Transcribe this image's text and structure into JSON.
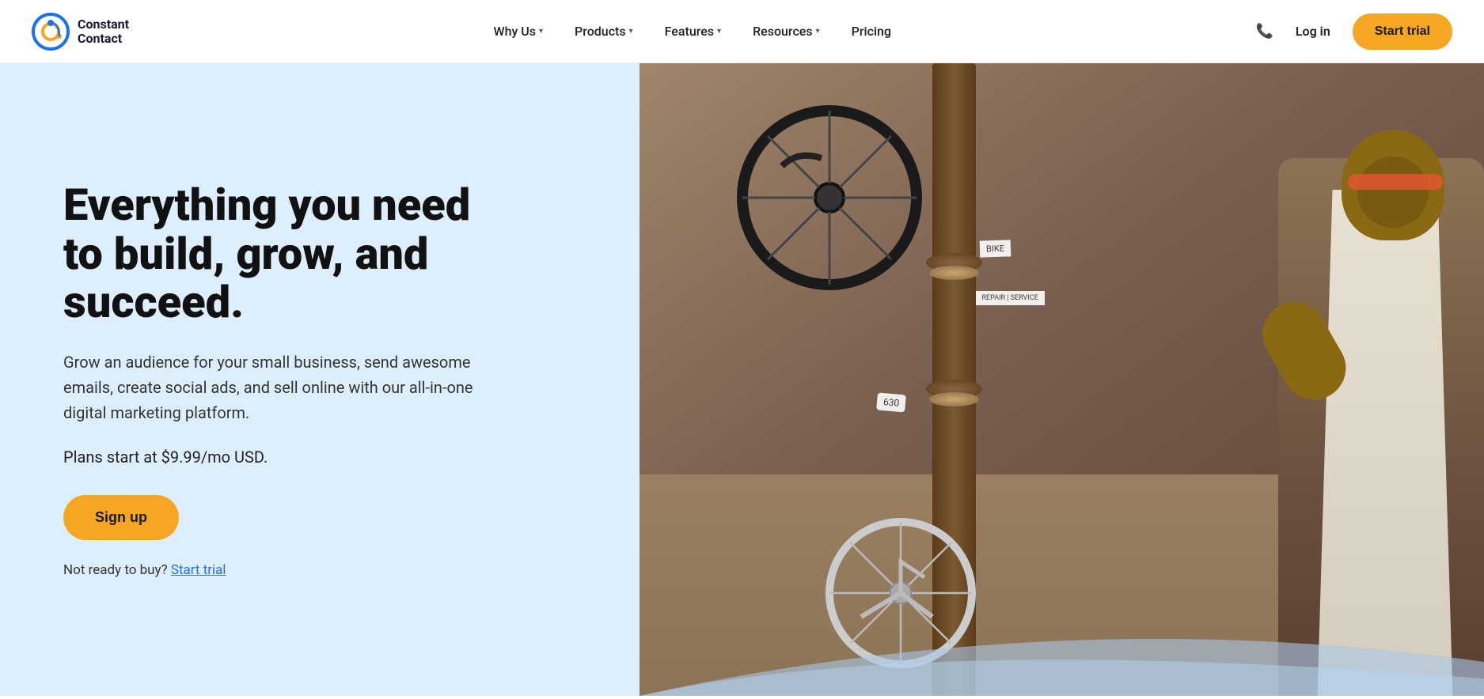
{
  "navbar": {
    "logo": {
      "line1": "Constant",
      "line2": "Contact"
    },
    "nav_items": [
      {
        "label": "Why Us",
        "has_dropdown": true
      },
      {
        "label": "Products",
        "has_dropdown": true
      },
      {
        "label": "Features",
        "has_dropdown": true
      },
      {
        "label": "Resources",
        "has_dropdown": true
      },
      {
        "label": "Pricing",
        "has_dropdown": false
      }
    ],
    "log_in_label": "Log in",
    "start_trial_label": "Start trial"
  },
  "hero": {
    "title": "Everything you need to build, grow, and succeed.",
    "description": "Grow an audience for your small business, send awesome emails, create social ads, and sell online with our all-in-one digital marketing platform.",
    "price_text": "Plans start at $9.99/mo USD.",
    "signup_label": "Sign up",
    "not_ready_text": "Not ready to buy?",
    "start_trial_link": "Start trial"
  },
  "colors": {
    "hero_bg": "#ddeeff",
    "circle_bg": "#b8d4ef",
    "button_orange": "#f5a623",
    "link_blue": "#1a73e8"
  }
}
